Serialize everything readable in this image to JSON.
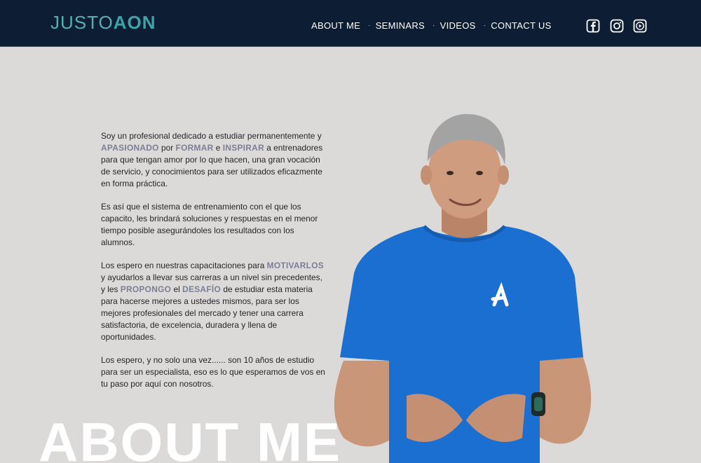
{
  "header": {
    "logo_part1": "JUSTO",
    "logo_part2": "AON",
    "nav": [
      {
        "label": "ABOUT ME"
      },
      {
        "label": "SEMINARS"
      },
      {
        "label": "VIDEOS"
      },
      {
        "label": "CONTACT US"
      }
    ],
    "nav_separator": "·",
    "social": [
      {
        "icon": "facebook-icon"
      },
      {
        "icon": "instagram-icon"
      },
      {
        "icon": "youtube-icon"
      }
    ]
  },
  "content": {
    "p1": {
      "t1": "Soy un profesional dedicado a estudiar permanentemente y ",
      "h1": "APASIONADO",
      "t2": " por ",
      "h2": "FORMAR",
      "t3": " e ",
      "h3": "INSPIRAR",
      "t4": " a entrenadores para que tengan amor por lo que hacen, una gran vocación de servicio, y conocimientos para ser utilizados eficazmente en forma práctica."
    },
    "p2": "Es así que el sistema de entrenamiento con el que los capacito, les brindará soluciones y respuestas en el menor tiempo posible asegurándoles los resultados con los alumnos.",
    "p3": {
      "t1": "Los espero en nuestras capacitaciones para ",
      "h1": "MOTIVARLOS",
      "t2": " y ayudarlos a llevar sus carreras a un nivel sin precedentes, y les ",
      "h2": "PROPONGO",
      "t3": " el ",
      "h3": "DESAFÍO",
      "t4": " de estudiar esta materia para hacerse mejores a ustedes mismos, para ser los mejores profesionales del mercado y tener una carrera satisfactoria, de excelencia, duradera y llena de oportunidades."
    },
    "p4": "Los espero, y no solo una vez...... son 10 años de estudio para ser un especialista, eso es lo que esperamos de vos en tu paso por aquí con nosotros."
  },
  "big_title": "ABOUT ME",
  "colors": {
    "header_bg": "#0d1e34",
    "page_bg": "#dcd9d9",
    "logo": "#3ea3a5",
    "highlight": "#7a7f96",
    "shirt": "#1a6fd0"
  }
}
